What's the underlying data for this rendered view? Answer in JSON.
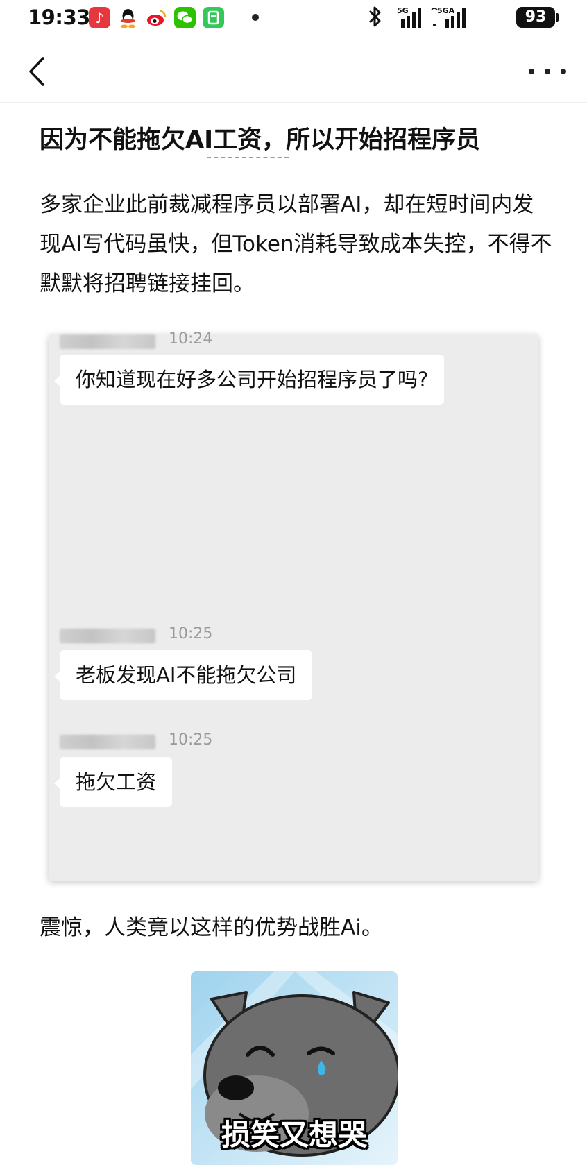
{
  "status_bar": {
    "time": "19:33",
    "signal_1_label": "5G",
    "signal_2_label": "5GA",
    "battery": "93",
    "apps": [
      {
        "name": "music-app-icon",
        "color": "#e8363f",
        "glyph": "♪"
      },
      {
        "name": "qq-app-icon",
        "color": "#ffffff",
        "glyph": "🐧"
      },
      {
        "name": "weibo-app-icon",
        "color": "#ffffff",
        "glyph": "◉"
      },
      {
        "name": "wechat-app-icon",
        "color": "#2dc100",
        "glyph": "✉"
      },
      {
        "name": "green-app-icon",
        "color": "#35c759",
        "glyph": "◔"
      }
    ]
  },
  "nav": {
    "back_icon": "chevron-left-icon",
    "more_icon": "more-horizontal-icon"
  },
  "article": {
    "title": "因为不能拖欠AI工资，所以开始招程序员",
    "paragraph_1": "多家企业此前裁减程序员以部署AI，却在短时间内发现AI写代码虽快，但Token消耗导致成本失控，不得不默默将招聘链接挂回。",
    "paragraph_2": "震惊，人类竟以这样的优势战胜Ai。",
    "accent_color": "#43c5a4"
  },
  "chat": {
    "messages": [
      {
        "time": "10:24",
        "text": "你知道现在好多公司开始招程序员了吗?"
      },
      {
        "time": "10:25",
        "text": "老板发现AI不能拖欠公司"
      },
      {
        "time": "10:25",
        "text": "拖欠工资"
      }
    ]
  },
  "sticker": {
    "caption": "损笑又想哭"
  }
}
